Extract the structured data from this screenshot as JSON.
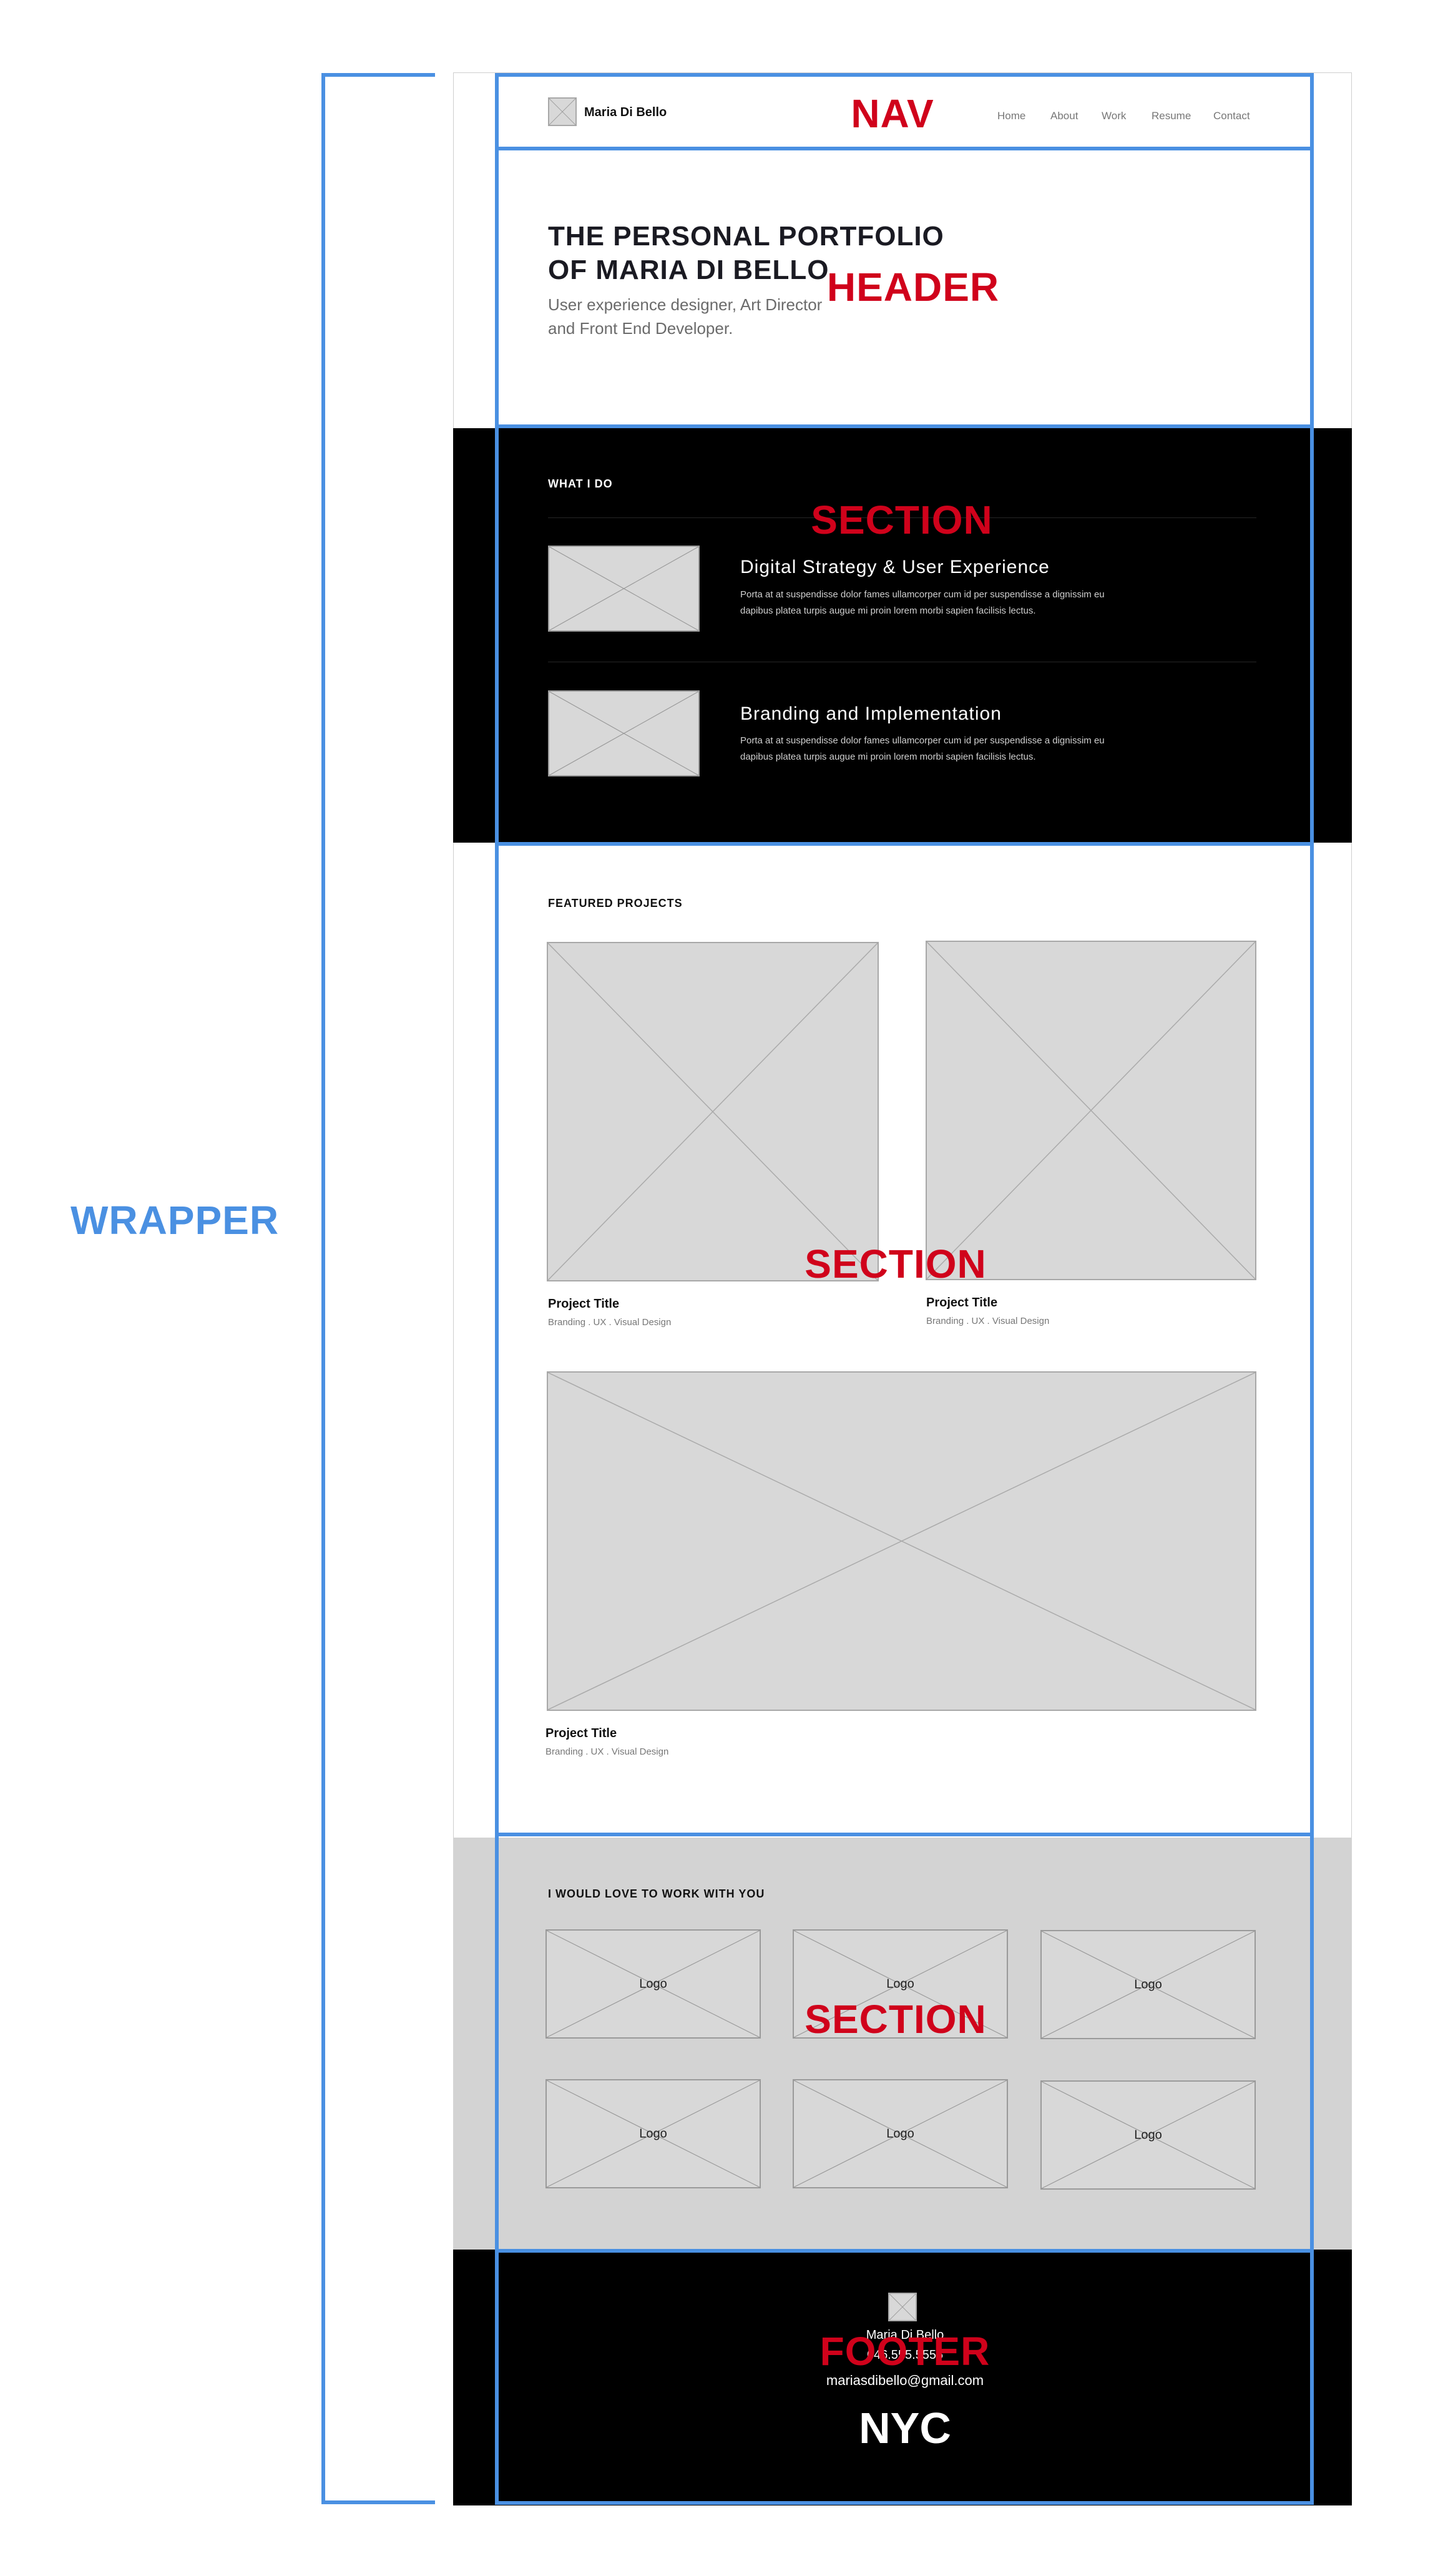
{
  "annotations": {
    "wrapper": "WRAPPER",
    "nav": "NAV",
    "header": "HEADER",
    "section": "SECTION",
    "footer": "FOOTER"
  },
  "colors": {
    "annotation_blue": "#4a90e2",
    "annotation_red": "#d0021b",
    "dark_band": "#000000",
    "gray_band": "#d3d3d3"
  },
  "nav": {
    "logo_icon": "image-placeholder-icon",
    "brand": "Maria Di Bello",
    "links": [
      "Home",
      "About",
      "Work",
      "Resume",
      "Contact"
    ]
  },
  "header": {
    "title_line1": "THE PERSONAL PORTFOLIO",
    "title_line2": "OF MARIA DI BELLO",
    "subtitle_line1": "User experience designer, Art Director",
    "subtitle_line2": "and Front End Developer."
  },
  "what_i_do": {
    "title": "WHAT I DO",
    "services": [
      {
        "title": "Digital Strategy & User Experience",
        "text_line1": "Porta at at suspendisse dolor fames ullamcorper cum id per suspendisse a dignissim eu",
        "text_line2": "dapibus platea turpis augue mi proin lorem morbi sapien facilisis lectus."
      },
      {
        "title": "Branding and Implementation",
        "text_line1": "Porta at at suspendisse dolor fames ullamcorper cum id per suspendisse a dignissim eu",
        "text_line2": "dapibus platea turpis augue mi proin lorem morbi sapien facilisis lectus."
      }
    ]
  },
  "featured": {
    "title": "FEATURED PROJECTS",
    "projects": [
      {
        "title": "Project Title",
        "tags": "Branding . UX . Visual Design"
      },
      {
        "title": "Project Title",
        "tags": "Branding . UX . Visual Design"
      },
      {
        "title": "Project Title",
        "tags": "Branding . UX . Visual Design"
      }
    ]
  },
  "clients": {
    "title": "I WOULD LOVE TO WORK WITH YOU",
    "logos": [
      "Logo",
      "Logo",
      "Logo",
      "Logo",
      "Logo",
      "Logo"
    ]
  },
  "footer": {
    "logo_icon": "image-placeholder-icon",
    "name": "Maria Di Bello",
    "phone": "646.555.5555",
    "email": "mariasdibello@gmail.com",
    "city": "NYC"
  }
}
